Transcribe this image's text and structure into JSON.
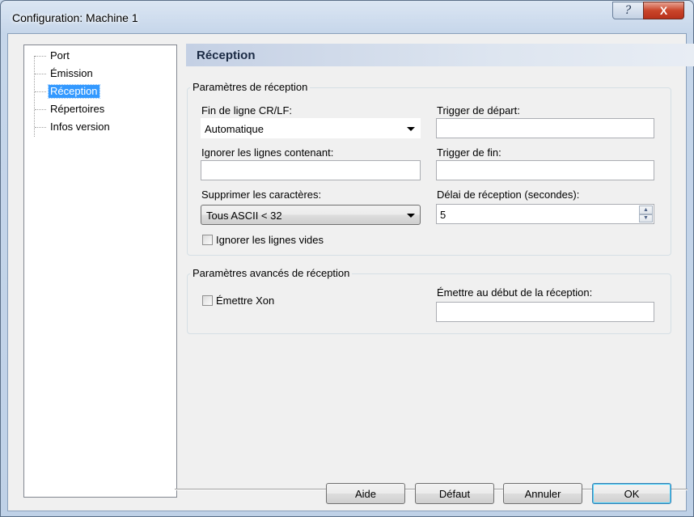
{
  "window": {
    "title": "Configuration: Machine 1"
  },
  "titlebar": {
    "help_glyph": "?",
    "close_glyph": "X"
  },
  "sidebar": {
    "items": [
      {
        "label": "Port"
      },
      {
        "label": "Émission"
      },
      {
        "label": "Réception",
        "selected": true
      },
      {
        "label": "Répertoires"
      },
      {
        "label": "Infos version"
      }
    ]
  },
  "pane": {
    "title": "Réception"
  },
  "reception_group": {
    "label": "Paramètres de réception",
    "eol_label": "Fin de ligne CR/LF:",
    "eol_value": "Automatique",
    "trigger_start_label": "Trigger de départ:",
    "trigger_start_value": "",
    "ignore_lines_label": "Ignorer les lignes contenant:",
    "ignore_lines_value": "",
    "trigger_end_label": "Trigger de fin:",
    "trigger_end_value": "",
    "remove_chars_label": "Supprimer les caractères:",
    "remove_chars_value": "Tous ASCII < 32",
    "delay_label": "Délai de réception (secondes):",
    "delay_value": "5",
    "ignore_empty_label": "Ignorer les lignes vides",
    "ignore_empty_checked": false
  },
  "advanced_group": {
    "label": "Paramètres avancés de réception",
    "xon_label": "Émettre Xon",
    "xon_checked": false,
    "emit_start_label": "Émettre au début de la réception:",
    "emit_start_value": ""
  },
  "buttons": {
    "help": "Aide",
    "default": "Défaut",
    "cancel": "Annuler",
    "ok": "OK"
  }
}
